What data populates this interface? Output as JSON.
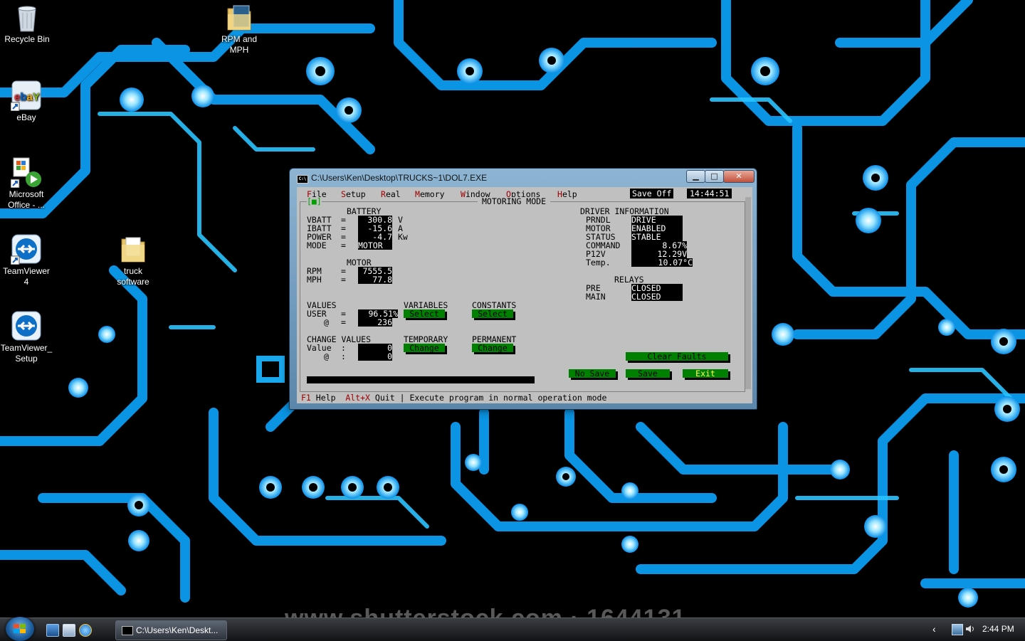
{
  "desktop": {
    "icons": [
      {
        "label": "Recycle Bin",
        "icon": "recycle-bin-icon"
      },
      {
        "label": "RPM  and\nMPH",
        "icon": "folder-icon"
      },
      {
        "label": "eBay",
        "icon": "ebay-shortcut-icon"
      },
      {
        "label": "Microsoft\nOffice - ...",
        "icon": "office-shortcut-icon"
      },
      {
        "label": "truck\nsoftware",
        "icon": "folder-icon"
      },
      {
        "label": "TeamViewer\n4",
        "icon": "teamviewer-icon"
      },
      {
        "label": "TeamViewer_\nSetup",
        "icon": "teamviewer-icon"
      }
    ],
    "watermark": "www.shutterstock.com  ·  1644131"
  },
  "window": {
    "title": "C:\\Users\\Ken\\Desktop\\TRUCKS~1\\DOL7.EXE",
    "buttons": {
      "minimize": "▁",
      "maximize": "□",
      "close": "✕"
    }
  },
  "app": {
    "menu": [
      {
        "hotkey": "F",
        "rest": "ile"
      },
      {
        "hotkey": "S",
        "rest": "etup"
      },
      {
        "hotkey": "R",
        "rest": "eal"
      },
      {
        "hotkey": "M",
        "rest": "emory"
      },
      {
        "hotkey": "W",
        "rest": "indow"
      },
      {
        "hotkey": "O",
        "rest": "ptions"
      },
      {
        "hotkey": "H",
        "rest": "elp"
      }
    ],
    "save_status": "Save Off",
    "time": "14:44:51",
    "mode_title": "MOTORING MODE",
    "battery": {
      "heading": "BATTERY",
      "rows": [
        {
          "label": "VBATT",
          "value": "300.8",
          "unit": "V"
        },
        {
          "label": "IBATT",
          "value": "-15.6",
          "unit": "A"
        },
        {
          "label": "POWER",
          "value": "-4.7",
          "unit": "Kw"
        },
        {
          "label": "MODE",
          "value": "MOTOR",
          "unit": ""
        }
      ]
    },
    "motor": {
      "heading": "MOTOR",
      "rows": [
        {
          "label": "RPM",
          "value": "7555.5"
        },
        {
          "label": "MPH",
          "value": "77.8"
        }
      ]
    },
    "values": {
      "heading": "VALUES",
      "user_label": "USER",
      "user_value": "96.51%",
      "at_label": "@",
      "at_value": "236"
    },
    "variables": {
      "heading": "VARIABLES",
      "button": "Select"
    },
    "constants": {
      "heading": "CONSTANTS",
      "button": "Select"
    },
    "change_values": {
      "heading": "CHANGE VALUES",
      "value_label": "Value",
      "value": "0",
      "at_label": "@",
      "at_value": "0"
    },
    "temporary": {
      "heading": "TEMPORARY",
      "button": "Change"
    },
    "permanent": {
      "heading": "PERMANENT",
      "button": "Change"
    },
    "driver_info": {
      "heading": "DRIVER INFORMATION",
      "rows": [
        {
          "label": "PRNDL",
          "value": "DRIVE"
        },
        {
          "label": "MOTOR",
          "value": "ENABLED"
        },
        {
          "label": "STATUS",
          "value": "STABLE"
        },
        {
          "label": "COMMAND",
          "value": "8.67%"
        },
        {
          "label": "P12V",
          "value": "12.29V"
        },
        {
          "label": "Temp.",
          "value": "10.07°C"
        }
      ]
    },
    "relays": {
      "heading": "RELAYS",
      "rows": [
        {
          "label": "PRE",
          "value": "CLOSED"
        },
        {
          "label": "MAIN",
          "value": "CLOSED"
        }
      ]
    },
    "buttons": {
      "clear_faults": "Clear Faults",
      "no_save": "No Save",
      "save": "Save",
      "exit": "Exit"
    },
    "status_bar": {
      "f1_key": "F1",
      "f1_text": "Help",
      "altx_key": "Alt+X",
      "altx_text": "Quit",
      "separator": "|",
      "message": "Execute program in normal operation mode"
    }
  },
  "taskbar": {
    "task_label": "C:\\Users\\Ken\\Deskt...",
    "clock": "2:44 PM",
    "tray_chevron": "‹"
  },
  "colors": {
    "console_bg": "#c0c0c0",
    "value_bg": "#000000",
    "button_green": "#008000",
    "hotkey_red": "#a00000",
    "circuit_blue": "#0aa8ff"
  }
}
